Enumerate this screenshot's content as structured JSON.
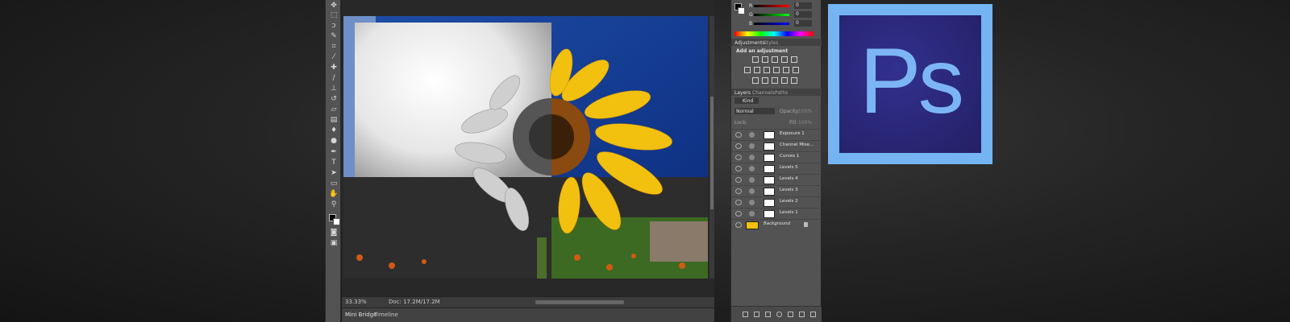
{
  "logo": {
    "text": "Ps"
  },
  "status": {
    "zoom": "33.33%",
    "doc": "Doc: 17.2M/17.2M"
  },
  "bottom_tabs": [
    "Mini Bridge",
    "Timeline"
  ],
  "panels": {
    "color_labels": {
      "r": "R",
      "g": "G",
      "b": "B"
    },
    "color_values": {
      "r": "0",
      "g": "0",
      "b": "0"
    },
    "adjust_tabs": [
      "Adjustments",
      "Styles"
    ],
    "add_adjustment": "Add an adjustment",
    "layer_tabs": [
      "Layers",
      "Channels",
      "Paths"
    ],
    "kind": "Kind",
    "blend": "Normal",
    "opacity_label": "Opacity:",
    "opacity": "100%",
    "lock_label": "Lock:",
    "fill_label": "Fill:",
    "fill": "100%",
    "layers": [
      "Exposure 1",
      "Channel Mixe...",
      "Curves 1",
      "Levels 5",
      "Levels 4",
      "Levels 3",
      "Levels 2",
      "Levels 1",
      "Background"
    ]
  }
}
